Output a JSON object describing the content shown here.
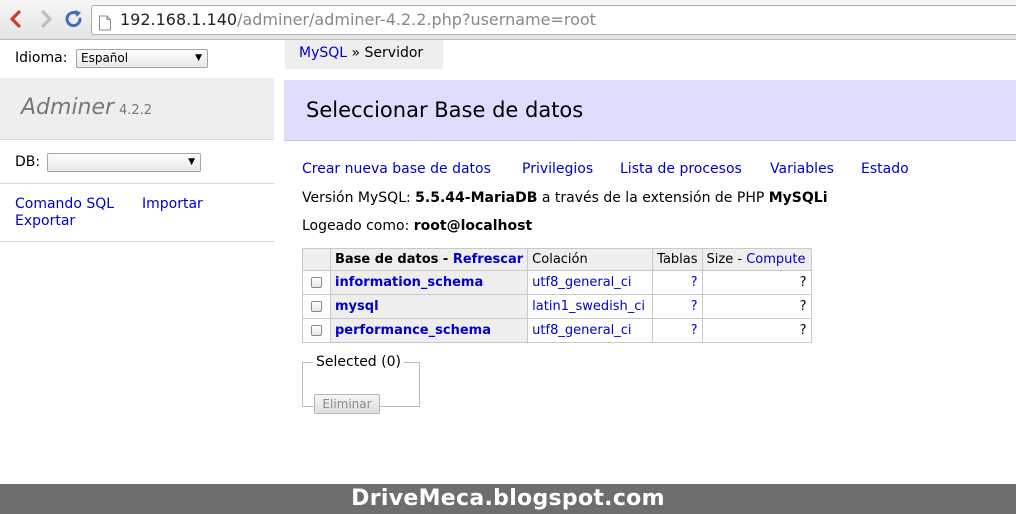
{
  "browser": {
    "url_host": "192.168.1.140",
    "url_path": "/adminer/adminer-4.2.2.php?username=root"
  },
  "menu": {
    "language_label": "Idioma:",
    "language_value": "Español",
    "app_name": "Adminer",
    "app_version": "4.2.2",
    "db_label": "DB:",
    "db_value": "",
    "links": {
      "sql_command": "Comando SQL",
      "import": "Importar",
      "export": "Exportar"
    }
  },
  "breadcrumb": {
    "driver": "MySQL",
    "separator": " » ",
    "current": "Servidor"
  },
  "page_title": "Seleccionar Base de datos",
  "actions": {
    "create_db": "Crear nueva base de datos",
    "privileges": "Privilegios",
    "processes": "Lista de procesos",
    "variables": "Variables",
    "status": "Estado"
  },
  "info": {
    "version_prefix": "Versión MySQL: ",
    "version": "5.5.44-MariaDB",
    "version_mid": " a través de la extensión de PHP ",
    "extension": "MySQLi",
    "logged_prefix": "Logeado como: ",
    "logged_user": "root@localhost"
  },
  "table": {
    "header": {
      "database": "Base de datos",
      "dash": " - ",
      "refresh": "Refrescar",
      "collation": "Colación",
      "tables": "Tablas",
      "size": "Size",
      "compute": "Compute"
    },
    "rows": [
      {
        "name": "information_schema",
        "collation": "utf8_general_ci",
        "tables": "?",
        "size": "?"
      },
      {
        "name": "mysql",
        "collation": "latin1_swedish_ci",
        "tables": "?",
        "size": "?"
      },
      {
        "name": "performance_schema",
        "collation": "utf8_general_ci",
        "tables": "?",
        "size": "?"
      }
    ]
  },
  "selected": {
    "legend": "Selected (0)",
    "delete_button": "Eliminar"
  },
  "watermark": "DriveMeca.blogspot.com",
  "colors": {
    "link": "#0000cc",
    "header_band": "#ddddff",
    "menu_band": "#eeeeee",
    "footer": "#6e6e6e"
  }
}
